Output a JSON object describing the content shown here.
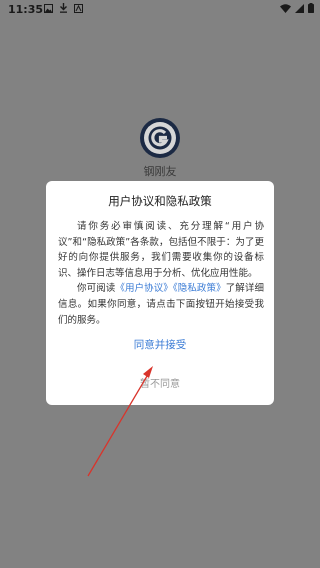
{
  "status_bar": {
    "time": "11:35",
    "left_icons": [
      "image-icon",
      "download-icon",
      "app-icon"
    ],
    "right_icons": [
      "wifi-icon",
      "signal-icon",
      "battery-icon"
    ]
  },
  "app": {
    "name": "钢刚友",
    "logo_letter": "G"
  },
  "dialog": {
    "title": "用户协议和隐私政策",
    "para1": "请你务必审慎阅读、充分理解“用户协议”和“隐私政策”各条款，包括但不限于：为了更好的向你提供服务，我们需要收集你的设备标识、操作日志等信息用于分析、优化应用性能。",
    "para2_prefix": "你可阅读",
    "link_user": "《用户协议》",
    "link_privacy": "《隐私政策》",
    "para2_suffix": "了解详细信息。如果你同意，请点击下面按钮开始接受我们的服务。",
    "agree_label": "同意并接受",
    "disagree_label": "暂不同意"
  },
  "colors": {
    "overlay": "#828282",
    "link": "#3a7bd5",
    "annotation_arrow": "#d9342b"
  }
}
